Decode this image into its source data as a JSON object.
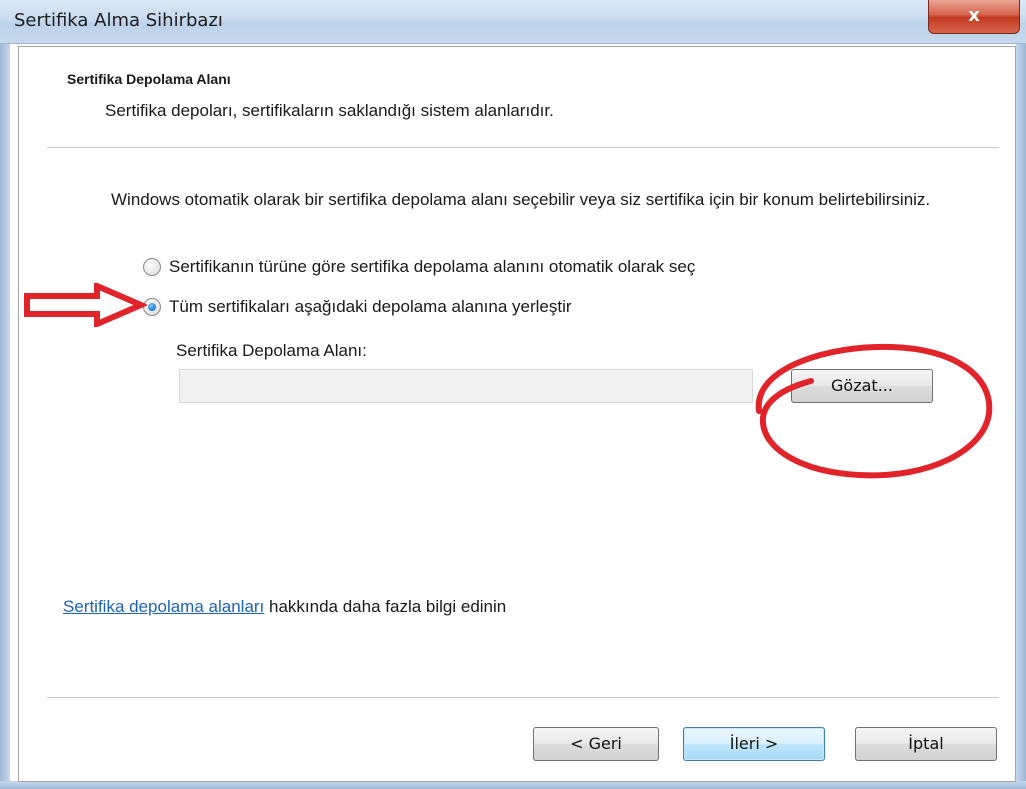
{
  "window": {
    "title": "Sertifika Alma Sihirbazı",
    "close_label": "x"
  },
  "header": {
    "section_title": "Sertifika Depolama Alanı",
    "section_description": "Sertifika depoları, sertifikaların saklandığı sistem alanlarıdır."
  },
  "body": {
    "intro": "Windows otomatik olarak bir sertifika depolama alanı seçebilir veya siz sertifika için bir konum belirtebilirsiniz.",
    "options": [
      {
        "label": "Sertifikanın türüne göre sertifika depolama alanını otomatik olarak seç",
        "selected": false
      },
      {
        "label": "Tüm sertifikaları aşağıdaki depolama alanına yerleştir",
        "selected": true
      }
    ],
    "store_label": "Sertifika Depolama Alanı:",
    "store_value": "",
    "browse_label": "Gözat...",
    "info_link": "Sertifika depolama alanları",
    "info_suffix": " hakkında daha fazla bilgi edinin"
  },
  "footer": {
    "back_label": "< Geri",
    "next_label": "İleri >",
    "cancel_label": "İptal"
  },
  "annotations": {
    "arrow_color": "#e0242a",
    "ellipse_color": "#e0242a"
  },
  "colors": {
    "link": "#1c63b8",
    "title_bar": "#c9dbee",
    "close_button": "#c0391f"
  }
}
